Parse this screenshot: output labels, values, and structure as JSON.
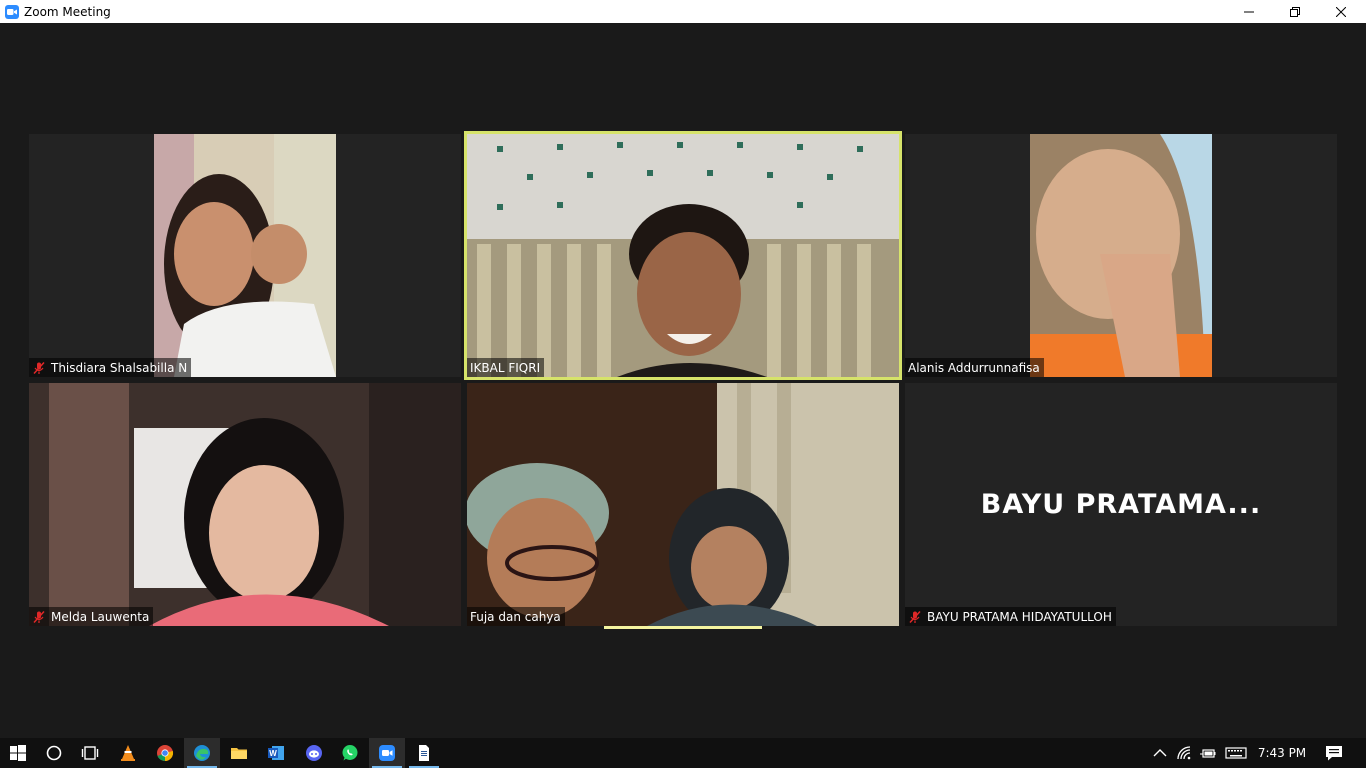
{
  "window": {
    "title": "Zoom Meeting",
    "app_icon": "zoom-icon",
    "controls": [
      "minimize-icon",
      "restore-icon",
      "close-icon"
    ]
  },
  "participants": [
    {
      "name": "Thisdiara Shalsabilla N",
      "muted": true,
      "video": true
    },
    {
      "name": "IKBAL FIQRI",
      "muted": false,
      "video": true,
      "active_speaker": true
    },
    {
      "name": "Alanis Addurrunnafisa",
      "muted": false,
      "video": true
    },
    {
      "name": "Melda Lauwenta",
      "muted": true,
      "video": true
    },
    {
      "name": "Fuja dan cahya",
      "muted": false,
      "video": true
    },
    {
      "name": "BAYU PRATAMA HIDAYATULLOH",
      "muted": true,
      "video": false,
      "display_label": "BAYU  PRATAMA..."
    }
  ],
  "colors": {
    "active_speaker_border": "#d6e36a",
    "mute_icon": "#e02828",
    "zoom_blue": "#2d8cff",
    "background": "#1a1a1a"
  },
  "taskbar": {
    "items": [
      "windows-start-icon",
      "search-icon",
      "task-view-icon",
      "vlc-icon",
      "chrome-icon",
      "edge-icon",
      "file-explorer-icon",
      "word-icon",
      "discord-icon",
      "whatsapp-icon",
      "zoom-icon",
      "document-icon"
    ],
    "tray": [
      "chevron-up-icon",
      "wifi-icon",
      "battery-icon",
      "keyboard-icon"
    ],
    "clock": "7:43 PM",
    "notification_icon": "action-center-icon"
  }
}
